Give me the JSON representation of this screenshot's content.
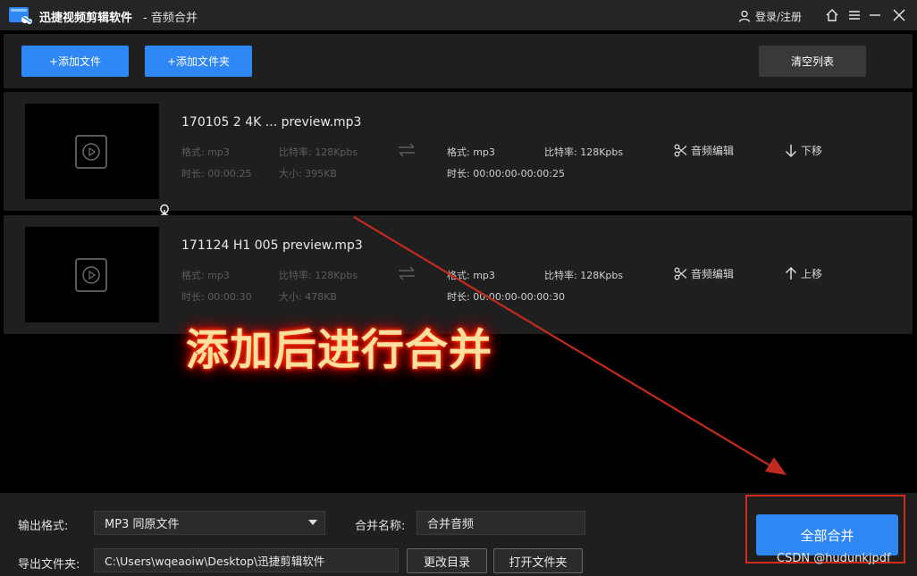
{
  "window": {
    "app_name": "迅捷视频剪辑软件",
    "subtitle": "- 音频合并",
    "login_label": "登录/注册"
  },
  "toolbar": {
    "add_file_label": "+添加文件",
    "add_folder_label": "+添加文件夹",
    "clear_list_label": "清空列表"
  },
  "files": [
    {
      "name": "170105 2 4K ... preview.mp3",
      "src_format": "格式: mp3",
      "src_bitrate": "比特率: 128Kpbs",
      "src_duration": "时长: 00:00:25",
      "src_size": "大小: 395KB",
      "out_format": "格式: mp3",
      "out_bitrate": "比特率: 128Kpbs",
      "out_duration": "时长: 00:00:00-00:00:25",
      "edit_label": "音频编辑",
      "move_label": "下移"
    },
    {
      "name": "171124 H1 005 preview.mp3",
      "src_format": "格式: mp3",
      "src_bitrate": "比特率: 128Kpbs",
      "src_duration": "时长: 00:00:30",
      "src_size": "大小: 478KB",
      "out_format": "格式: mp3",
      "out_bitrate": "比特率: 128Kpbs",
      "out_duration": "时长: 00:00:00-00:00:30",
      "edit_label": "音频编辑",
      "move_label": "上移"
    }
  ],
  "annotation": {
    "text": "添加后进行合并"
  },
  "bottom": {
    "output_format_label": "输出格式:",
    "output_format_value": "MP3 同原文件",
    "merge_name_label": "合并名称:",
    "merge_name_value": "合并音频",
    "export_folder_label": "导出文件夹:",
    "export_folder_value": "C:\\Users\\wqeaoiw\\Desktop\\迅捷剪辑软件",
    "change_dir_label": "更改目录",
    "open_folder_label": "打开文件夹",
    "merge_all_label": "全部合并"
  },
  "watermark": "CSDN @hudunkjpdf",
  "colors": {
    "accent": "#2f86f5",
    "panel": "#1f1f20",
    "annotation_red": "#d42a1c"
  }
}
